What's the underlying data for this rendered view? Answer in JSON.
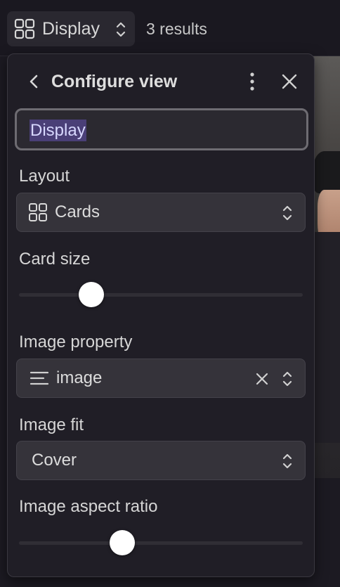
{
  "topbar": {
    "display_label": "Display",
    "results_text": "3 results"
  },
  "panel": {
    "title": "Configure view",
    "name_value": "Display",
    "layout": {
      "label": "Layout",
      "value": "Cards"
    },
    "card_size": {
      "label": "Card size",
      "fraction": 0.23
    },
    "image_property": {
      "label": "Image property",
      "value": "image"
    },
    "image_fit": {
      "label": "Image fit",
      "value": "Cover"
    },
    "image_aspect_ratio": {
      "label": "Image aspect ratio",
      "fraction": 0.35
    }
  },
  "icons": {
    "display": "grid-icon",
    "back": "chevron-left-icon",
    "more": "more-vertical-icon",
    "close": "close-icon",
    "select": "chevron-updown-icon",
    "property": "text-lines-icon",
    "clear": "clear-icon"
  },
  "colors": {
    "background": "#1c1a22",
    "panel": "#201e26",
    "input": "#35333a",
    "selection": "#4a3f77",
    "thumb": "#ffffff"
  }
}
